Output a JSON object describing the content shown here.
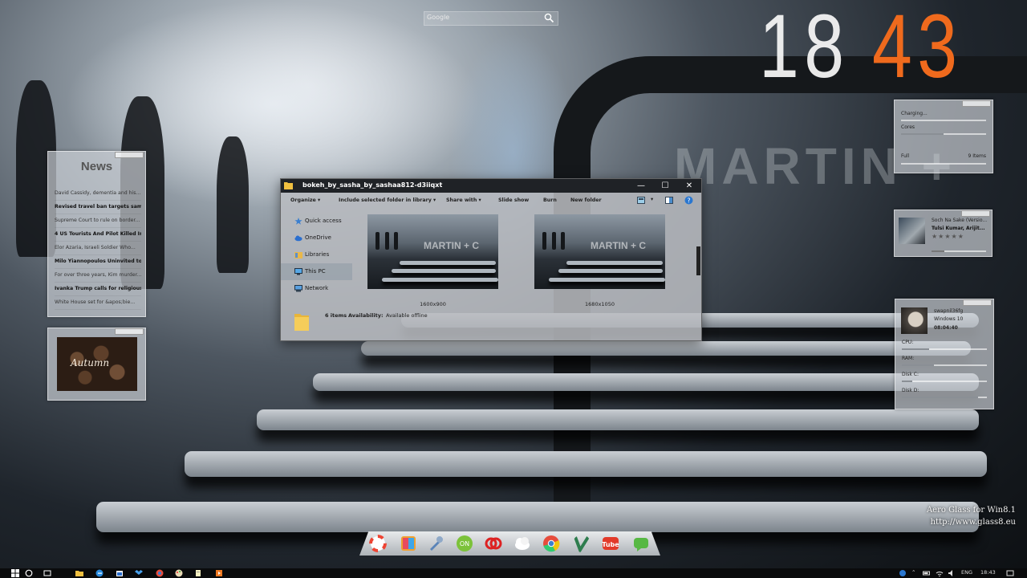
{
  "search": {
    "placeholder": "Google",
    "icon": "search-icon"
  },
  "clock": {
    "hours": "18",
    "minutes": "43",
    "minutes_color": "#ef6a1d"
  },
  "news": {
    "title": "News",
    "items": [
      "David Cassidy, dementia and his...",
      "Revised travel ban targets same...",
      "Supreme Court to rule on border...",
      "4 US Tourists And Pilot Killed In A...",
      "Elor Azaria, Israeli Soldier Who...",
      "Milo Yiannopoulos Uninvited to...",
      "For over three years, Kim murder...",
      "Ivanka Trump calls for religious...",
      "White House set for &apos;bie..."
    ],
    "bold_items": [
      1,
      3,
      5,
      7
    ]
  },
  "photo": {
    "caption": "Autumn"
  },
  "power": {
    "charging": "Charging...",
    "cores": "Cores",
    "full": "Full",
    "items": "9 Items",
    "cores_level": 0.5,
    "charge_level": 0.0
  },
  "music": {
    "title": "Soch Na Sake (Versio...",
    "artist": "Tulsi Kumar, Arijit...",
    "stars": "★★★★★",
    "progress": 0.24
  },
  "system": {
    "user": "swapnil36fg",
    "os": "Windows 10",
    "uptime": "08:04:40",
    "cpu_label": "CPU:",
    "ram_label": "RAM:",
    "diskc_label": "Disk C:",
    "diskd_label": "Disk D:",
    "cpu": 0.32,
    "ram": 0.38,
    "diskc": 0.12,
    "diskd": 0.9
  },
  "explorer": {
    "title": "bokeh_by_sasha_by_sashaa812-d3iiqxt",
    "toolbar": {
      "organize": "Organize",
      "include": "Include selected folder in library",
      "share": "Share with",
      "slideshow": "Slide show",
      "burn": "Burn",
      "newfolder": "New folder"
    },
    "nav": [
      "Quick access",
      "OneDrive",
      "Libraries",
      "This PC",
      "Network"
    ],
    "selected_nav": "This PC",
    "files": [
      {
        "label": "1600x900"
      },
      {
        "label": "1680x1050"
      }
    ],
    "status": {
      "count": "6 items",
      "availability_label": "Availability:",
      "availability": "Available offline"
    }
  },
  "aero": {
    "line1": "Aero Glass for Win8.1",
    "line2": "http://www.glass8.eu"
  },
  "tray": {
    "lang": "ENG",
    "time": "18:43"
  },
  "dock_icons": [
    "lifebuoy-icon",
    "palette-icon",
    "tools-icon",
    "green-toggle-icon",
    "red-link-icon",
    "cloud-icon",
    "chrome-icon",
    "vine-icon",
    "tube-icon",
    "green-chat-icon"
  ]
}
